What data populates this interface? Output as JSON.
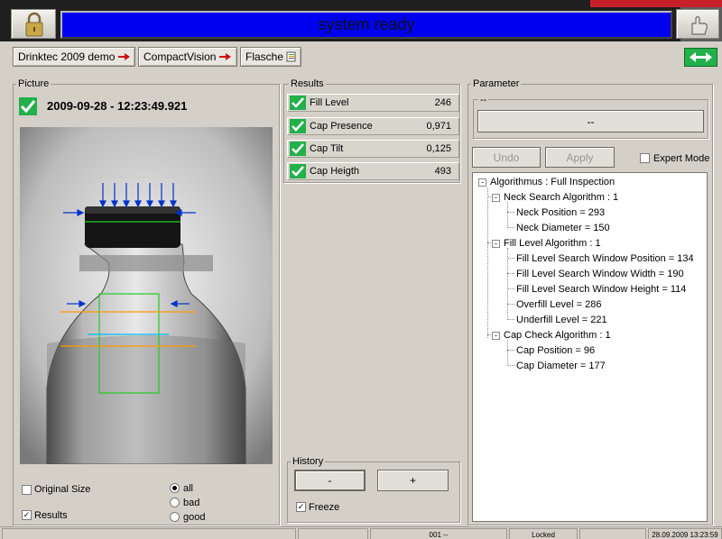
{
  "header": {
    "status_text": "system ready",
    "lock_icon": "padlock-icon",
    "hand_icon": "hand-pointer-icon",
    "status_color": "#0000f0"
  },
  "toolbar": {
    "breadcrumbs": [
      {
        "label": "Drinktec 2009 demo",
        "icon": "red-arrow-icon"
      },
      {
        "label": "CompactVision",
        "icon": "red-arrow-icon"
      },
      {
        "label": "Flasche",
        "icon": "document-icon"
      }
    ],
    "switch_icon": "double-arrow-icon",
    "accent_color": "#22b04a"
  },
  "picture": {
    "group_label": "Picture",
    "timestamp": "2009-09-28 - 12:23:49.921",
    "original_size_label": "Original Size",
    "original_size_checked": false,
    "results_label": "Results",
    "results_checked": true,
    "filter_options": [
      "all",
      "bad",
      "good"
    ],
    "filter_selected": "all"
  },
  "results": {
    "group_label": "Results",
    "rows": [
      {
        "name": "Fill Level",
        "value": "246"
      },
      {
        "name": "Cap Presence",
        "value": "0,971"
      },
      {
        "name": "Cap Tilt",
        "value": "0,125"
      },
      {
        "name": "Cap Heigth",
        "value": "493"
      }
    ]
  },
  "history": {
    "group_label": "History",
    "minus_label": "-",
    "plus_label": "+",
    "freeze_label": "Freeze",
    "freeze_checked": true
  },
  "parameter": {
    "group_label": "Parameter",
    "sub_label": "--",
    "button_label": "--",
    "undo_label": "Undo",
    "apply_label": "Apply",
    "expert_label": "Expert Mode",
    "expert_checked": false,
    "tree": [
      {
        "level": 0,
        "text": "Algorithmus : Full Inspection",
        "expander": "-"
      },
      {
        "level": 1,
        "text": "Neck Search Algorithm : 1",
        "expander": "-"
      },
      {
        "level": 2,
        "text": "Neck Position = 293"
      },
      {
        "level": 2,
        "text": "Neck Diameter = 150"
      },
      {
        "level": 1,
        "text": "Fill Level Algorithm : 1",
        "expander": "-"
      },
      {
        "level": 2,
        "text": "Fill Level Search Window Position = 134"
      },
      {
        "level": 2,
        "text": "Fill Level Search Window Width = 190"
      },
      {
        "level": 2,
        "text": "Fill Level Search Window Height = 114"
      },
      {
        "level": 2,
        "text": "Overfill Level = 286"
      },
      {
        "level": 2,
        "text": "Underfill Level = 221"
      },
      {
        "level": 1,
        "text": "Cap Check Algorithm : 1",
        "expander": "-"
      },
      {
        "level": 2,
        "text": "Cap Position = 96"
      },
      {
        "level": 2,
        "text": "Cap Diameter = 177"
      }
    ]
  },
  "footer": {
    "cells": [
      "",
      "",
      "001 --",
      "Locked",
      "",
      "28.09.2009 13:23:59"
    ]
  }
}
